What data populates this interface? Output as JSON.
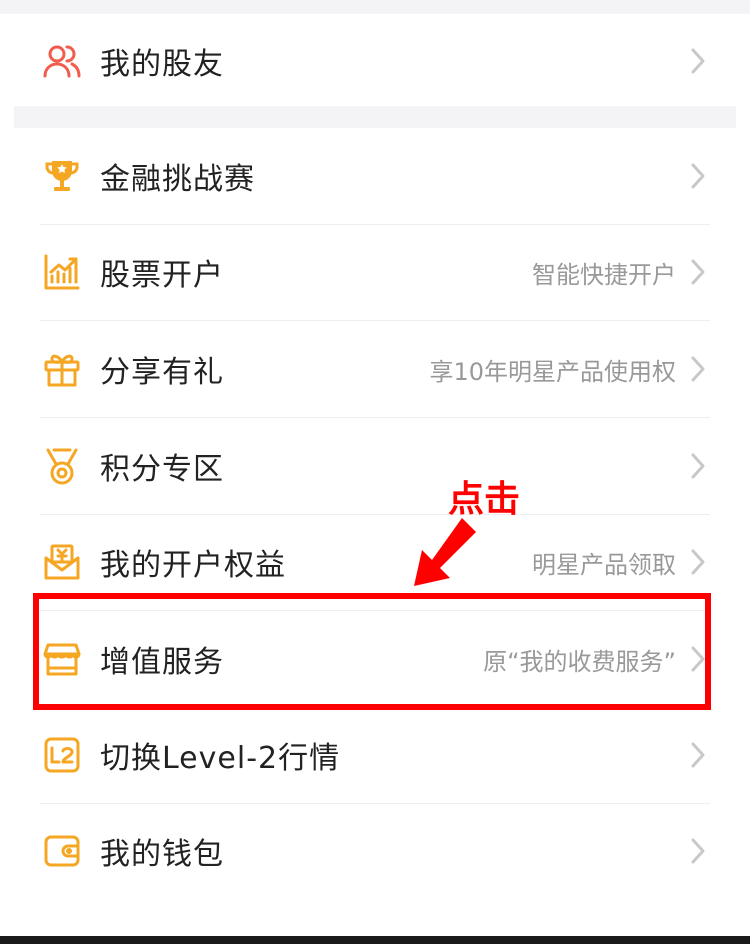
{
  "menu": {
    "items": [
      {
        "label": "我的股友",
        "hint": "",
        "icon": "users-icon"
      },
      {
        "label": "金融挑战赛",
        "hint": "",
        "icon": "trophy-icon"
      },
      {
        "label": "股票开户",
        "hint": "智能快捷开户",
        "icon": "stock-chart-icon"
      },
      {
        "label": "分享有礼",
        "hint": "享10年明星产品使用权",
        "icon": "gift-icon"
      },
      {
        "label": "积分专区",
        "hint": "",
        "icon": "medal-icon"
      },
      {
        "label": "我的开户权益",
        "hint": "明星产品领取",
        "icon": "yuan-envelope-icon"
      },
      {
        "label": "增值服务",
        "hint": "原“我的收费服务”",
        "icon": "store-icon"
      },
      {
        "label": "切换Level-2行情",
        "hint": "",
        "icon": "l2-icon"
      },
      {
        "label": "我的钱包",
        "hint": "",
        "icon": "wallet-icon"
      }
    ]
  },
  "annotation": {
    "text": "点击",
    "color": "#ff0000"
  },
  "colors": {
    "icon_orange": "#f5a623",
    "icon_red": "#f25c4c",
    "text": "#222222",
    "hint": "#999999"
  }
}
